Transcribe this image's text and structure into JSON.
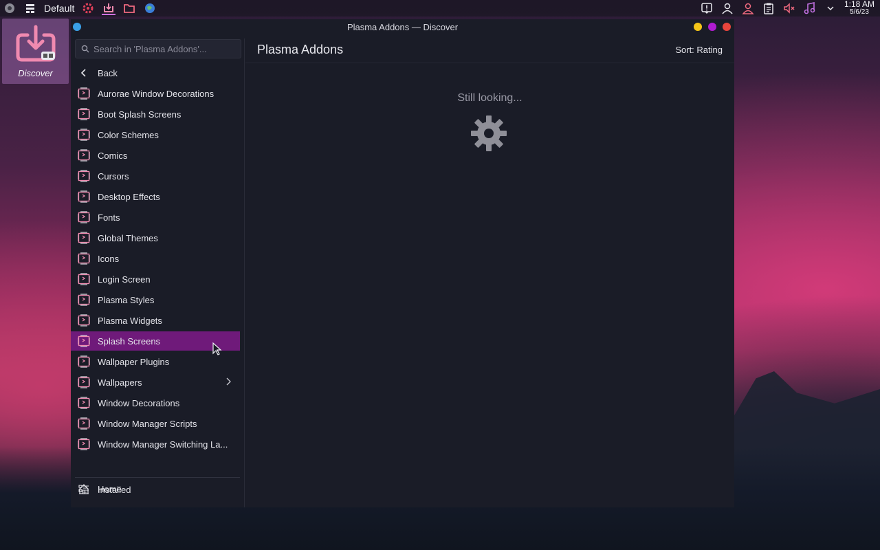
{
  "panel": {
    "activity": "Default",
    "clock_time": "1:18 AM",
    "clock_date": "5/6/23"
  },
  "desktop": {
    "discover_label": "Discover"
  },
  "window": {
    "title": "Plasma Addons — Discover",
    "buttons": {
      "minimize": "#f5c518",
      "maximize": "#b01cd0",
      "close": "#e8453c"
    }
  },
  "sidebar": {
    "search_placeholder": "Search in 'Plasma Addons'...",
    "back": "Back",
    "categories": [
      "Aurorae Window Decorations",
      "Boot Splash Screens",
      "Color Schemes",
      "Comics",
      "Cursors",
      "Desktop Effects",
      "Fonts",
      "Global Themes",
      "Icons",
      "Login Screen",
      "Plasma Styles",
      "Plasma Widgets",
      "Splash Screens",
      "Wallpaper Plugins",
      "Wallpapers",
      "Window Decorations",
      "Window Manager Scripts",
      "Window Manager Switching La..."
    ],
    "active_category": "Splash Screens",
    "home": "Home",
    "installed": "Installed"
  },
  "main": {
    "title": "Plasma Addons",
    "sort": "Sort: Rating",
    "status": "Still looking..."
  },
  "colors": {
    "accent": "#6f1a7a",
    "icon_pink": "#f08ab0",
    "window_bg": "#1a1c27"
  }
}
